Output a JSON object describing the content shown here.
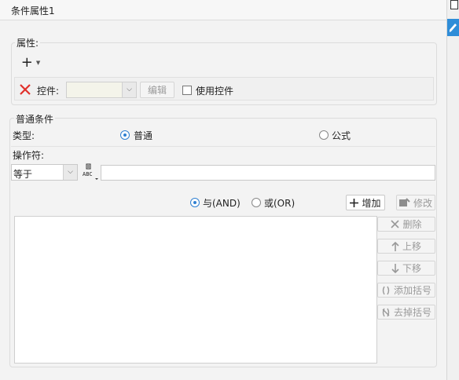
{
  "window": {
    "title": "条件属性1"
  },
  "attributes": {
    "section_label": "属性:",
    "add_symbol": "+",
    "control_label": "控件:",
    "control_value": "",
    "edit_label": "编辑",
    "use_control_label": "使用控件"
  },
  "condition": {
    "section_label": "普通条件",
    "type_label": "类型:",
    "type_normal": "普通",
    "type_formula": "公式",
    "operator_label": "操作符:",
    "operator_value": "等于",
    "value_input": "",
    "and_label": "与(AND)",
    "or_label": "或(OR)",
    "add_label": "增加",
    "modify_label": "修改",
    "delete_label": "删除",
    "up_label": "上移",
    "down_label": "下移",
    "add_bracket_label": "添加括号",
    "remove_bracket_label": "去掉括号",
    "abc_icon_text": "ABC"
  },
  "colors": {
    "accent": "#2f7fd1",
    "delete_red": "#e0302a",
    "rail_active": "#2f8dd8"
  }
}
